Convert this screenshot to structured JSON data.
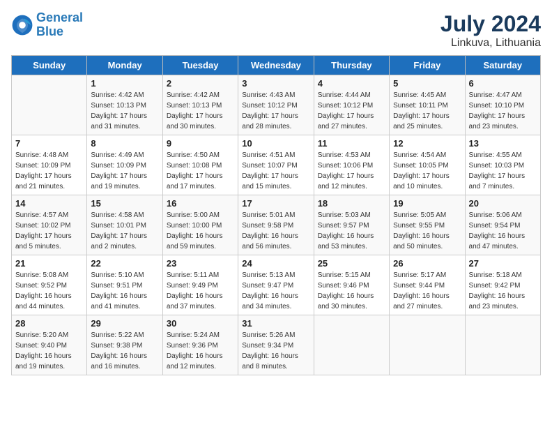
{
  "header": {
    "logo_line1": "General",
    "logo_line2": "Blue",
    "month": "July 2024",
    "location": "Linkuva, Lithuania"
  },
  "weekdays": [
    "Sunday",
    "Monday",
    "Tuesday",
    "Wednesday",
    "Thursday",
    "Friday",
    "Saturday"
  ],
  "weeks": [
    [
      {
        "day": "",
        "empty": true
      },
      {
        "day": "1",
        "sunrise": "4:42 AM",
        "sunset": "10:13 PM",
        "daylight": "17 hours and 31 minutes."
      },
      {
        "day": "2",
        "sunrise": "4:42 AM",
        "sunset": "10:13 PM",
        "daylight": "17 hours and 30 minutes."
      },
      {
        "day": "3",
        "sunrise": "4:43 AM",
        "sunset": "10:12 PM",
        "daylight": "17 hours and 28 minutes."
      },
      {
        "day": "4",
        "sunrise": "4:44 AM",
        "sunset": "10:12 PM",
        "daylight": "17 hours and 27 minutes."
      },
      {
        "day": "5",
        "sunrise": "4:45 AM",
        "sunset": "10:11 PM",
        "daylight": "17 hours and 25 minutes."
      },
      {
        "day": "6",
        "sunrise": "4:47 AM",
        "sunset": "10:10 PM",
        "daylight": "17 hours and 23 minutes."
      }
    ],
    [
      {
        "day": "7",
        "sunrise": "4:48 AM",
        "sunset": "10:09 PM",
        "daylight": "17 hours and 21 minutes."
      },
      {
        "day": "8",
        "sunrise": "4:49 AM",
        "sunset": "10:09 PM",
        "daylight": "17 hours and 19 minutes."
      },
      {
        "day": "9",
        "sunrise": "4:50 AM",
        "sunset": "10:08 PM",
        "daylight": "17 hours and 17 minutes."
      },
      {
        "day": "10",
        "sunrise": "4:51 AM",
        "sunset": "10:07 PM",
        "daylight": "17 hours and 15 minutes."
      },
      {
        "day": "11",
        "sunrise": "4:53 AM",
        "sunset": "10:06 PM",
        "daylight": "17 hours and 12 minutes."
      },
      {
        "day": "12",
        "sunrise": "4:54 AM",
        "sunset": "10:05 PM",
        "daylight": "17 hours and 10 minutes."
      },
      {
        "day": "13",
        "sunrise": "4:55 AM",
        "sunset": "10:03 PM",
        "daylight": "17 hours and 7 minutes."
      }
    ],
    [
      {
        "day": "14",
        "sunrise": "4:57 AM",
        "sunset": "10:02 PM",
        "daylight": "17 hours and 5 minutes."
      },
      {
        "day": "15",
        "sunrise": "4:58 AM",
        "sunset": "10:01 PM",
        "daylight": "17 hours and 2 minutes."
      },
      {
        "day": "16",
        "sunrise": "5:00 AM",
        "sunset": "10:00 PM",
        "daylight": "16 hours and 59 minutes."
      },
      {
        "day": "17",
        "sunrise": "5:01 AM",
        "sunset": "9:58 PM",
        "daylight": "16 hours and 56 minutes."
      },
      {
        "day": "18",
        "sunrise": "5:03 AM",
        "sunset": "9:57 PM",
        "daylight": "16 hours and 53 minutes."
      },
      {
        "day": "19",
        "sunrise": "5:05 AM",
        "sunset": "9:55 PM",
        "daylight": "16 hours and 50 minutes."
      },
      {
        "day": "20",
        "sunrise": "5:06 AM",
        "sunset": "9:54 PM",
        "daylight": "16 hours and 47 minutes."
      }
    ],
    [
      {
        "day": "21",
        "sunrise": "5:08 AM",
        "sunset": "9:52 PM",
        "daylight": "16 hours and 44 minutes."
      },
      {
        "day": "22",
        "sunrise": "5:10 AM",
        "sunset": "9:51 PM",
        "daylight": "16 hours and 41 minutes."
      },
      {
        "day": "23",
        "sunrise": "5:11 AM",
        "sunset": "9:49 PM",
        "daylight": "16 hours and 37 minutes."
      },
      {
        "day": "24",
        "sunrise": "5:13 AM",
        "sunset": "9:47 PM",
        "daylight": "16 hours and 34 minutes."
      },
      {
        "day": "25",
        "sunrise": "5:15 AM",
        "sunset": "9:46 PM",
        "daylight": "16 hours and 30 minutes."
      },
      {
        "day": "26",
        "sunrise": "5:17 AM",
        "sunset": "9:44 PM",
        "daylight": "16 hours and 27 minutes."
      },
      {
        "day": "27",
        "sunrise": "5:18 AM",
        "sunset": "9:42 PM",
        "daylight": "16 hours and 23 minutes."
      }
    ],
    [
      {
        "day": "28",
        "sunrise": "5:20 AM",
        "sunset": "9:40 PM",
        "daylight": "16 hours and 19 minutes."
      },
      {
        "day": "29",
        "sunrise": "5:22 AM",
        "sunset": "9:38 PM",
        "daylight": "16 hours and 16 minutes."
      },
      {
        "day": "30",
        "sunrise": "5:24 AM",
        "sunset": "9:36 PM",
        "daylight": "16 hours and 12 minutes."
      },
      {
        "day": "31",
        "sunrise": "5:26 AM",
        "sunset": "9:34 PM",
        "daylight": "16 hours and 8 minutes."
      },
      {
        "day": "",
        "empty": true
      },
      {
        "day": "",
        "empty": true
      },
      {
        "day": "",
        "empty": true
      }
    ]
  ]
}
